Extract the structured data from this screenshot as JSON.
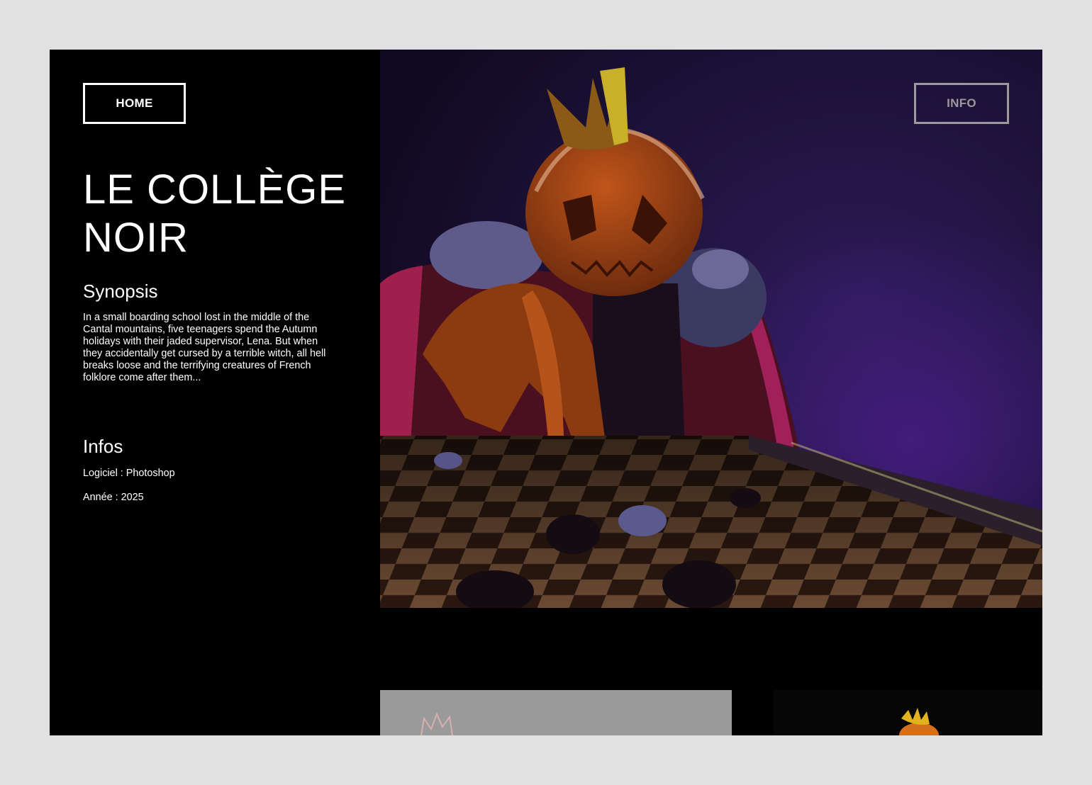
{
  "nav": {
    "home_label": "HOME",
    "info_label": "INFO"
  },
  "project": {
    "title_line1": "LE COLLÈGE",
    "title_line2": "NOIR"
  },
  "synopsis": {
    "heading": "Synopsis",
    "lines": [
      "In a small boarding school lost in the middle of the",
      "Cantal mountains, five teenagers spend the Autumn",
      "holidays with their jaded supervisor, Lena. But when",
      "they accidentally get cursed by a terrible witch, all hell",
      "breaks loose and the terrifying creatures of French",
      "folklore come after them..."
    ]
  },
  "infos": {
    "heading": "Infos",
    "software": "Logiciel : Photoshop",
    "year": "Année : 2025"
  },
  "colors": {
    "page_background": "#e1e1e1",
    "panel_background": "#000000",
    "text": "#ffffff",
    "info_button": "#9a9a9a"
  }
}
